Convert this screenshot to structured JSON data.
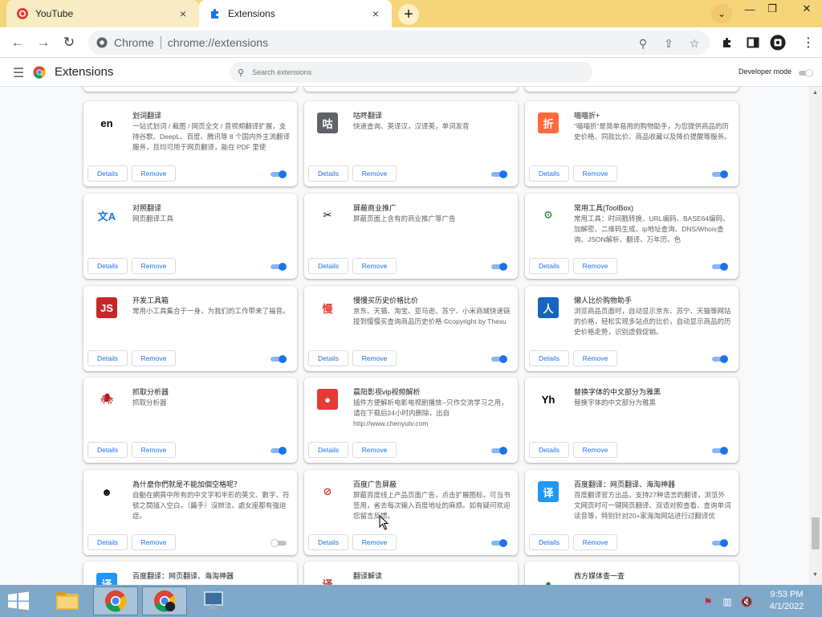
{
  "tabs": [
    {
      "title": "YouTube",
      "close": "×"
    },
    {
      "title": "Extensions",
      "close": "×"
    }
  ],
  "window_controls": {
    "dropdown": "⌄",
    "minimize": "—",
    "restore": "❐",
    "close": "✕"
  },
  "toolbar": {
    "site_label": "Chrome",
    "url": "chrome://extensions"
  },
  "header": {
    "title": "Extensions",
    "search_placeholder": "Search extensions",
    "developer_mode_label": "Developer mode",
    "developer_mode_on": false
  },
  "cards": [
    {
      "name": "划词翻译",
      "desc": "一站式划词 / 截图 / 网页全文 / 音视频翻译扩展，支持谷歌、DeepL、百度、腾讯等 8 个国内外主流翻译服务，且均可用于网页翻译，能在 PDF 里使",
      "icon": "translate-icon",
      "icon_text": "en",
      "icon_bg": "#ffffff",
      "icon_fg": "#000000",
      "enabled": true
    },
    {
      "name": "咕咚翻译",
      "desc": "快速查询、英译汉，汉译英，单词发音",
      "icon": "gudong-icon",
      "icon_text": "咕",
      "icon_bg": "#5f6368",
      "icon_fg": "#ffffff",
      "enabled": true
    },
    {
      "name": "喵喵折+",
      "desc": "\"喵喵折\"是简单易用的购物助手，为您提供商品的历史价格、同款比价、商品收藏以及降价提醒等服务。",
      "icon": "discount-icon",
      "icon_text": "折",
      "icon_bg": "#ff6a3d",
      "icon_fg": "#ffffff",
      "enabled": true
    },
    {
      "name": "对照翻译",
      "desc": "网页翻译工具",
      "icon": "google-translate-icon",
      "icon_text": "文A",
      "icon_bg": "#ffffff",
      "icon_fg": "#1a73e8",
      "enabled": true
    },
    {
      "name": "屏蔽商业推广",
      "desc": "屏蔽页面上含有的商业推广等广告",
      "icon": "scissors-icon",
      "icon_text": "✂",
      "icon_bg": "#ffffff",
      "icon_fg": "#000000",
      "enabled": true
    },
    {
      "name": "常用工具(ToolBox)",
      "desc": "常用工具：时间戳转换、URL编码、BASE64编码、加解密、二维码生成、ip地址查询、DNS/Whois查询、JSON解析、翻译、万年历、色",
      "icon": "gear-icon",
      "icon_text": "⚙",
      "icon_bg": "#ffffff",
      "icon_fg": "#188038",
      "enabled": true
    },
    {
      "name": "开发工具箱",
      "desc": "常用小工具集合于一身，为我们的工作带来了福音。",
      "icon": "js-icon",
      "icon_text": "JS",
      "icon_bg": "#c62828",
      "icon_fg": "#ffffff",
      "enabled": true
    },
    {
      "name": "慢慢买历史价格比价",
      "desc": "京东、天猫、淘宝、亚马逊、苏宁、小米商城快速链接到慢慢买查询商品历史价格 ©copyright by Thexu",
      "icon": "manmanbuy-icon",
      "icon_text": "慢",
      "icon_bg": "#ffffff",
      "icon_fg": "#e53935",
      "enabled": true
    },
    {
      "name": "懒人比价购物助手",
      "desc": "浏览商品页面时，自动显示京东、苏宁、天猫等网站的价格，轻松实现多站点的比价，自动显示商品的历史价格走势，识别虚假促销。",
      "icon": "person-icon",
      "icon_text": "人",
      "icon_bg": "#1565c0",
      "icon_fg": "#ffffff",
      "enabled": true
    },
    {
      "name": "抓取分析器",
      "desc": "抓取分析器",
      "icon": "spider-icon",
      "icon_text": "🕷",
      "icon_bg": "#ffffff",
      "icon_fg": "#b71c1c",
      "enabled": true
    },
    {
      "name": "晨阳影视vip视频解析",
      "desc": "插件方便解析电影电视剧播放--只作交流学习之用，请在下载后24小时内删除，出自 http://www.chenyutv.com",
      "icon": "video-icon",
      "icon_text": "●",
      "icon_bg": "#e53935",
      "icon_fg": "#ffffff",
      "enabled": true
    },
    {
      "name": "替换字体的中文部分为雅黑",
      "desc": "替换字体的中文部分为雅黑",
      "icon": "yh-font-icon",
      "icon_text": "Yh",
      "icon_bg": "#ffffff",
      "icon_fg": "#000000",
      "enabled": true
    },
    {
      "name": "為什麼你們就是不能加個空格呢？",
      "desc": "自動在網頁中所有的中文字和半形的英文、數字、符號之間插入空白。（醬手）沒辦法，處女座都有強迫症。",
      "icon": "afro-face-icon",
      "icon_text": "☻",
      "icon_bg": "#ffffff",
      "icon_fg": "#000000",
      "enabled": false
    },
    {
      "name": "百度广告屏蔽",
      "desc": "屏蔽百度线上产品页面广告，点击扩展图标，可当书签用，省去每次输入百度地址的麻烦。如有疑问欢迎您留言反馈。",
      "icon": "no-ads-icon",
      "icon_text": "⊘",
      "icon_bg": "#ffffff",
      "icon_fg": "#d32f2f",
      "enabled": true
    },
    {
      "name": "百度翻译：网页翻译、海淘神器",
      "desc": "百度翻译官方出品，支持27种语言的翻译，浏览外文网页时可一键网页翻译、双语对照查看、查询单词读音等，特别针对20+家海淘网站进行过翻译优",
      "icon": "baidu-translate-icon",
      "icon_text": "译",
      "icon_bg": "#2196f3",
      "icon_fg": "#ffffff",
      "enabled": true
    },
    {
      "name": "百度翻译：网页翻译、海淘神器",
      "desc": "",
      "icon": "baidu-translate-icon",
      "icon_text": "译",
      "icon_bg": "#2196f3",
      "icon_fg": "#ffffff",
      "enabled": true
    },
    {
      "name": "翻译解读",
      "desc": "",
      "icon": "translate-read-icon",
      "icon_text": "译",
      "icon_bg": "#ffffff",
      "icon_fg": "#d32f2f",
      "enabled": true
    },
    {
      "name": "西方媒体查一查",
      "desc": "",
      "icon": "media-check-icon",
      "icon_text": "●",
      "icon_bg": "#ffffff",
      "icon_fg": "#2e7d32",
      "enabled": true
    }
  ],
  "button_labels": {
    "details": "Details",
    "remove": "Remove"
  },
  "clock": {
    "time": "9:53 PM",
    "date": "4/1/2022"
  },
  "colors": {
    "accent": "#1a73e8",
    "titlebar": "#f5d57a",
    "taskbar": "#7fa8c9"
  }
}
